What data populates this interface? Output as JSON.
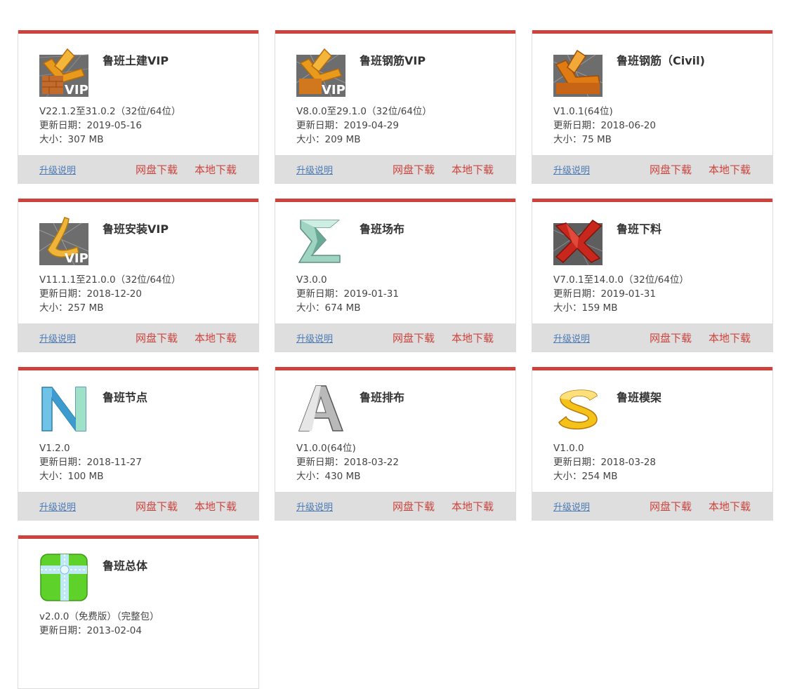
{
  "accent_color": "#cd433c",
  "link_color": "#4a7ab5",
  "labels": {
    "update_prefix": "更新日期：",
    "size_prefix": "大小：",
    "notes": "升级说明",
    "net_download": "网盘下载",
    "local_download": "本地下载"
  },
  "products": [
    {
      "name": "鲁班土建VIP",
      "version": "V22.1.2至31.0.2（32位/64位）",
      "update": "更新日期：2019-05-16",
      "size": "大小：307 MB",
      "icon": "luban-tujian-vip-icon"
    },
    {
      "name": "鲁班钢筋VIP",
      "version": "V8.0.0至29.1.0（32位/64位）",
      "update": "更新日期：2019-04-29",
      "size": "大小：209 MB",
      "icon": "luban-gangjin-vip-icon"
    },
    {
      "name": "鲁班钢筋（Civil)",
      "version": "V1.0.1(64位)",
      "update": "更新日期：2018-06-20",
      "size": "大小：75 MB",
      "icon": "luban-gangjin-civil-icon"
    },
    {
      "name": "鲁班安装VIP",
      "version": "V11.1.1至21.0.0（32位/64位）",
      "update": "更新日期：2018-12-20",
      "size": "大小：257 MB",
      "icon": "luban-anzhuang-vip-icon"
    },
    {
      "name": "鲁班场布",
      "version": "V3.0.0",
      "update": "更新日期：2019-01-31",
      "size": "大小：674 MB",
      "icon": "luban-changbu-icon"
    },
    {
      "name": "鲁班下料",
      "version": "V7.0.1至14.0.0（32位/64位）",
      "update": "更新日期：2019-01-31",
      "size": "大小：159 MB",
      "icon": "luban-xialiao-icon"
    },
    {
      "name": "鲁班节点",
      "version": "V1.2.0",
      "update": "更新日期：2018-11-27",
      "size": "大小：100 MB",
      "icon": "luban-jiedian-icon"
    },
    {
      "name": "鲁班排布",
      "version": "V1.0.0(64位)",
      "update": "更新日期：2018-03-22",
      "size": "大小：430 MB",
      "icon": "luban-paibu-icon"
    },
    {
      "name": "鲁班模架",
      "version": "V1.0.0",
      "update": "更新日期：2018-03-28",
      "size": "大小：254 MB",
      "icon": "luban-mojia-icon"
    },
    {
      "name": "鲁班总体",
      "version": "v2.0.0（免费版）（完整包）",
      "update": "更新日期：2013-02-04",
      "size": "",
      "icon": "luban-zongti-icon"
    }
  ]
}
